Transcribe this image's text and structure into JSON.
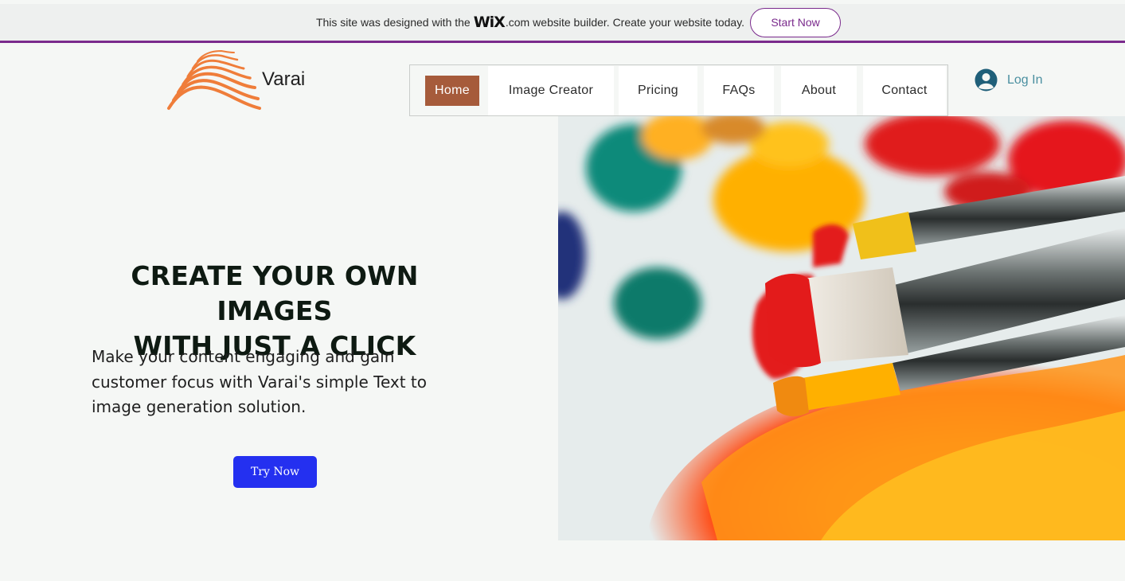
{
  "banner": {
    "text_before": "This site was designed with the",
    "wix": "WiX",
    "dotcom": ".com",
    "text_after": "website builder. Create your website today.",
    "button": "Start Now"
  },
  "header": {
    "brand": "Varai",
    "nav": [
      {
        "label": "Home",
        "active": true
      },
      {
        "label": "Image Creator"
      },
      {
        "label": "Pricing"
      },
      {
        "label": "FAQs"
      },
      {
        "label": "About"
      },
      {
        "label": "Contact"
      }
    ],
    "login": "Log In"
  },
  "hero": {
    "title_line1": "CREATE YOUR OWN IMAGES",
    "title_line2": "WITH JUST A CLICK",
    "subtitle": "Make your content engaging and gain customer focus with Varai's simple Text to image generation solution.",
    "cta": "Try Now"
  },
  "colors": {
    "accent": "#a65b3b",
    "wix_purple": "#7a2a8c",
    "cta_blue": "#2430f0",
    "login_teal": "#4a8fa0",
    "logo_orange": "#ef7d3a"
  },
  "icons": {
    "logo": "wave-logo-icon",
    "login": "user-avatar-icon",
    "hero": "paint-brushes-image"
  }
}
